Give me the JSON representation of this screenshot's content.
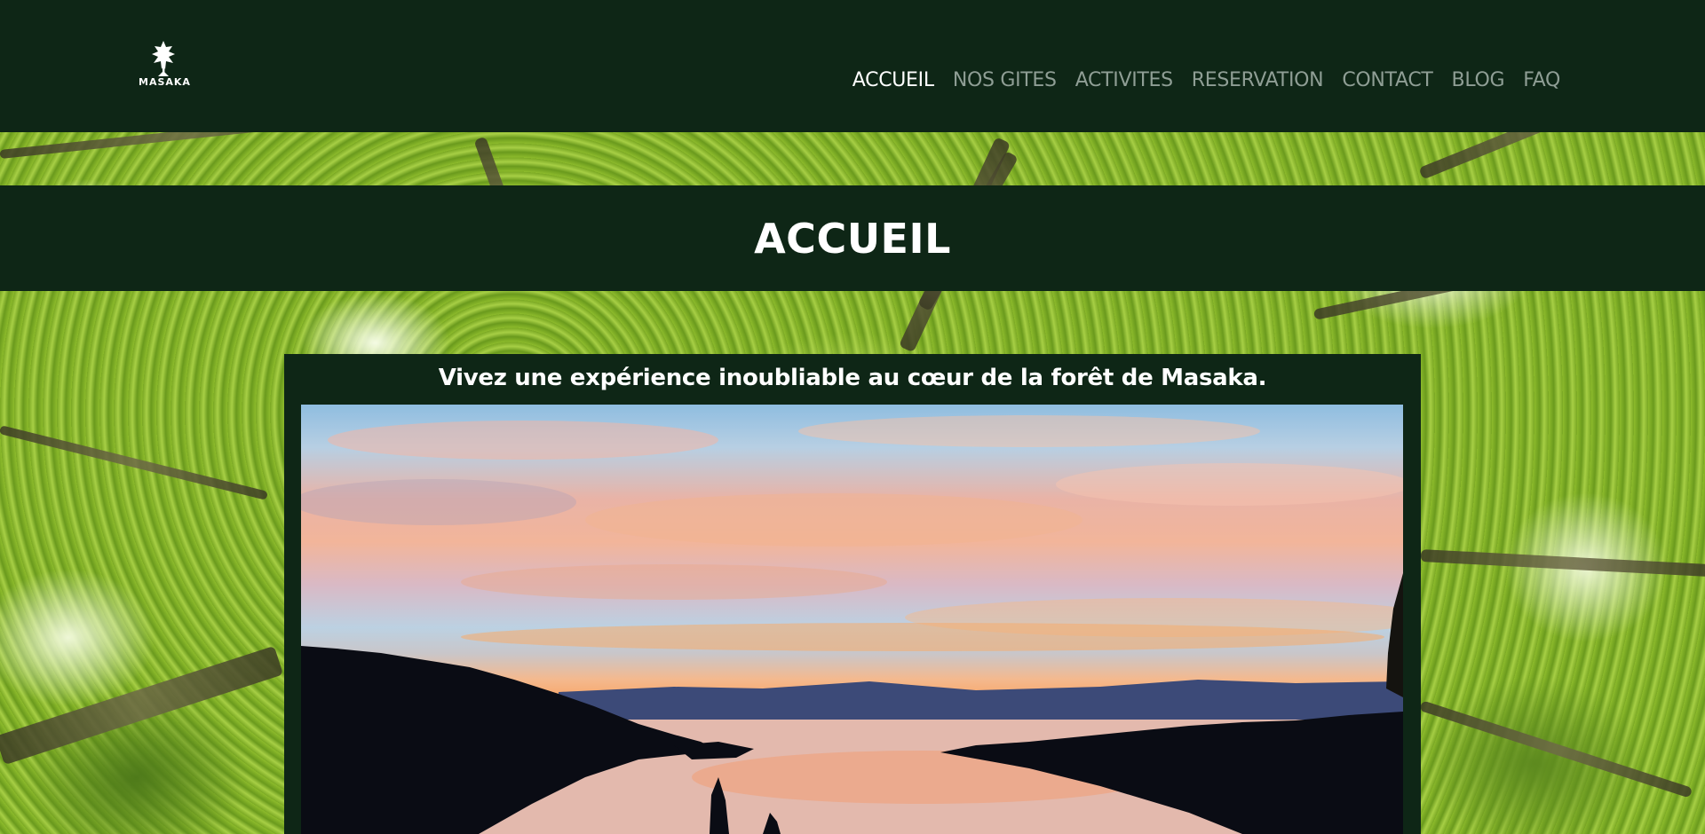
{
  "header": {
    "logo_text": "MASAKA",
    "nav": [
      {
        "label": "ACCUEIL",
        "active": true
      },
      {
        "label": "NOS GITES",
        "active": false
      },
      {
        "label": "ACTIVITES",
        "active": false
      },
      {
        "label": "RESERVATION",
        "active": false
      },
      {
        "label": "CONTACT",
        "active": false
      },
      {
        "label": "BLOG",
        "active": false
      },
      {
        "label": "FAQ",
        "active": false
      }
    ]
  },
  "page": {
    "title": "ACCUEIL",
    "tagline": "Vivez une expérience inoubliable au cœur de la forêt de Masaka."
  },
  "colors": {
    "dark_green": "#0e2616",
    "nav_inactive": "#8f9e95",
    "nav_active": "#ffffff"
  },
  "icons": {
    "logo": "tree-icon"
  }
}
